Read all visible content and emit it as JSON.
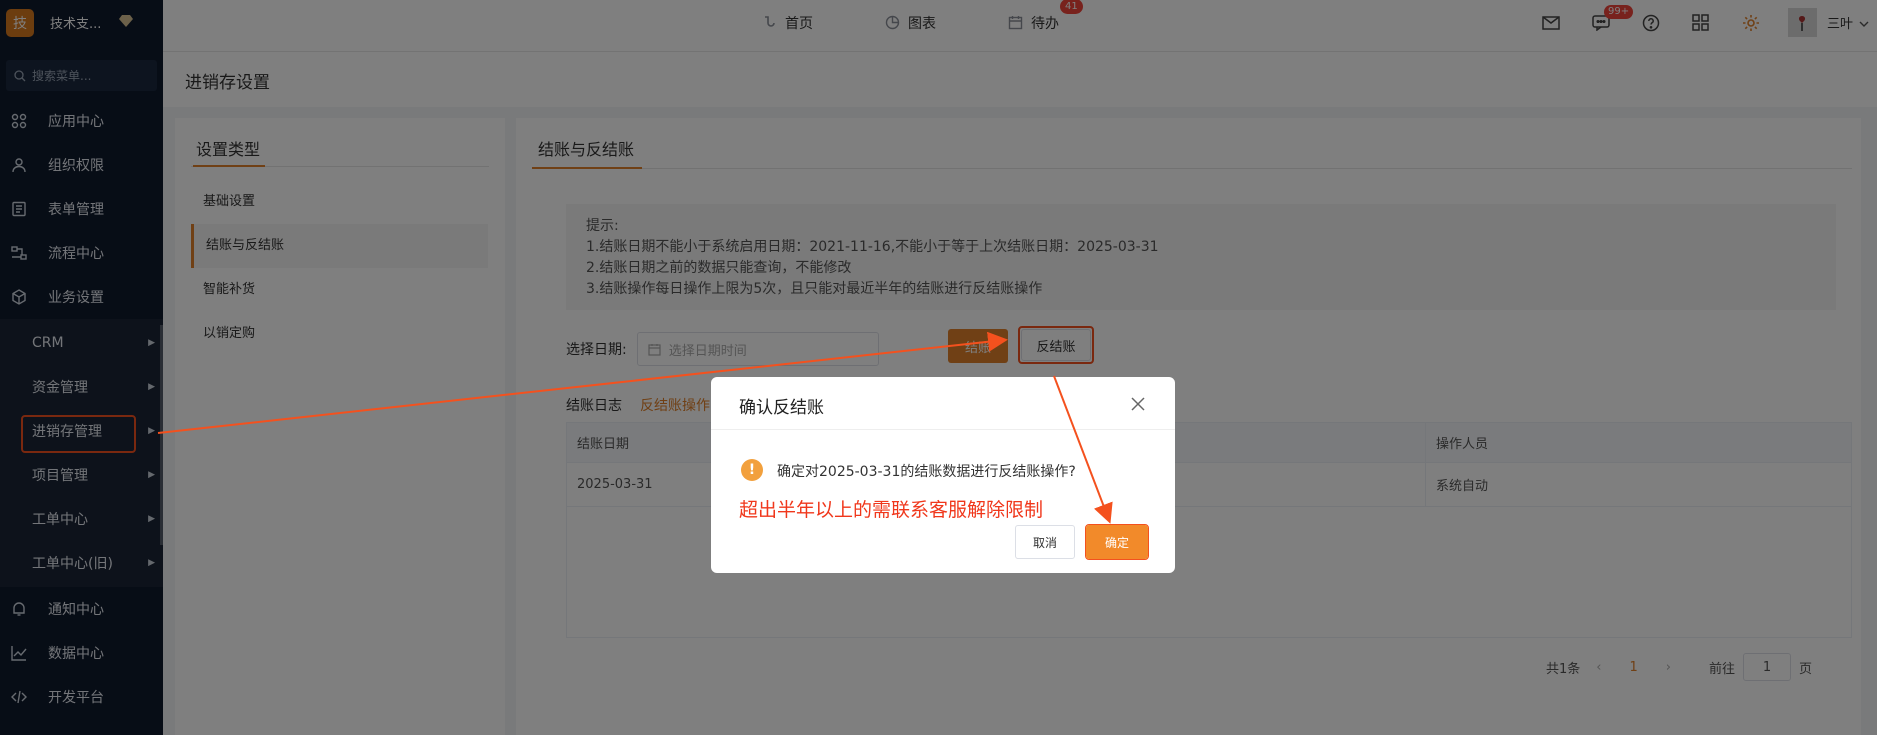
{
  "brand": {
    "logo_char": "技",
    "name": "技术支..."
  },
  "sidebar": {
    "search_placeholder": "搜索菜单...",
    "top_items": [
      {
        "label": "应用中心"
      },
      {
        "label": "组织权限"
      },
      {
        "label": "表单管理"
      },
      {
        "label": "流程中心"
      },
      {
        "label": "业务设置"
      }
    ],
    "sub_items": [
      {
        "label": "CRM"
      },
      {
        "label": "资金管理"
      },
      {
        "label": "进销存管理"
      },
      {
        "label": "项目管理"
      },
      {
        "label": "工单中心"
      },
      {
        "label": "工单中心(旧)"
      }
    ],
    "bottom_items": [
      {
        "label": "通知中心"
      },
      {
        "label": "数据中心"
      },
      {
        "label": "开发平台"
      }
    ]
  },
  "topbar": {
    "nav": [
      {
        "label": "首页"
      },
      {
        "label": "图表"
      },
      {
        "label": "待办",
        "badge": "41"
      }
    ],
    "message_badge": "99+",
    "username": "三叶"
  },
  "page": {
    "title": "进销存设置"
  },
  "left_panel": {
    "title": "设置类型",
    "items": [
      {
        "label": "基础设置"
      },
      {
        "label": "结账与反结账"
      },
      {
        "label": "智能补货"
      },
      {
        "label": "以销定购"
      }
    ]
  },
  "right_panel": {
    "title": "结账与反结账",
    "tips": [
      "提示:",
      "1.结账日期不能小于系统启用日期：2021-11-16,不能小于等于上次结账日期：2025-03-31",
      "2.结账日期之前的数据只能查询，不能修改",
      "3.结账操作每日操作上限为5次，且只能对最近半年的结账进行反结账操作"
    ],
    "date_label": "选择日期:",
    "date_placeholder": "选择日期时间",
    "close_btn": "结账",
    "reverse_btn": "反结账",
    "log_title": "结账日志",
    "log_link": "反结账操作",
    "table": {
      "headers": [
        "结账日期",
        "操作人员"
      ],
      "rows": [
        [
          "2025-03-31",
          "系统自动"
        ]
      ]
    },
    "pager": {
      "total": "共1条",
      "current": "1",
      "goto": "前往",
      "page_value": "1",
      "page_unit": "页"
    }
  },
  "dialog": {
    "title": "确认反结账",
    "message": "确定对2025-03-31的结账数据进行反结账操作?",
    "note": "超出半年以上的需联系客服解除限制",
    "cancel": "取消",
    "ok": "确定"
  },
  "colors": {
    "accent": "#e0802a",
    "annotation": "#f4511e",
    "sidebar_bg": "#0f1a2d"
  }
}
